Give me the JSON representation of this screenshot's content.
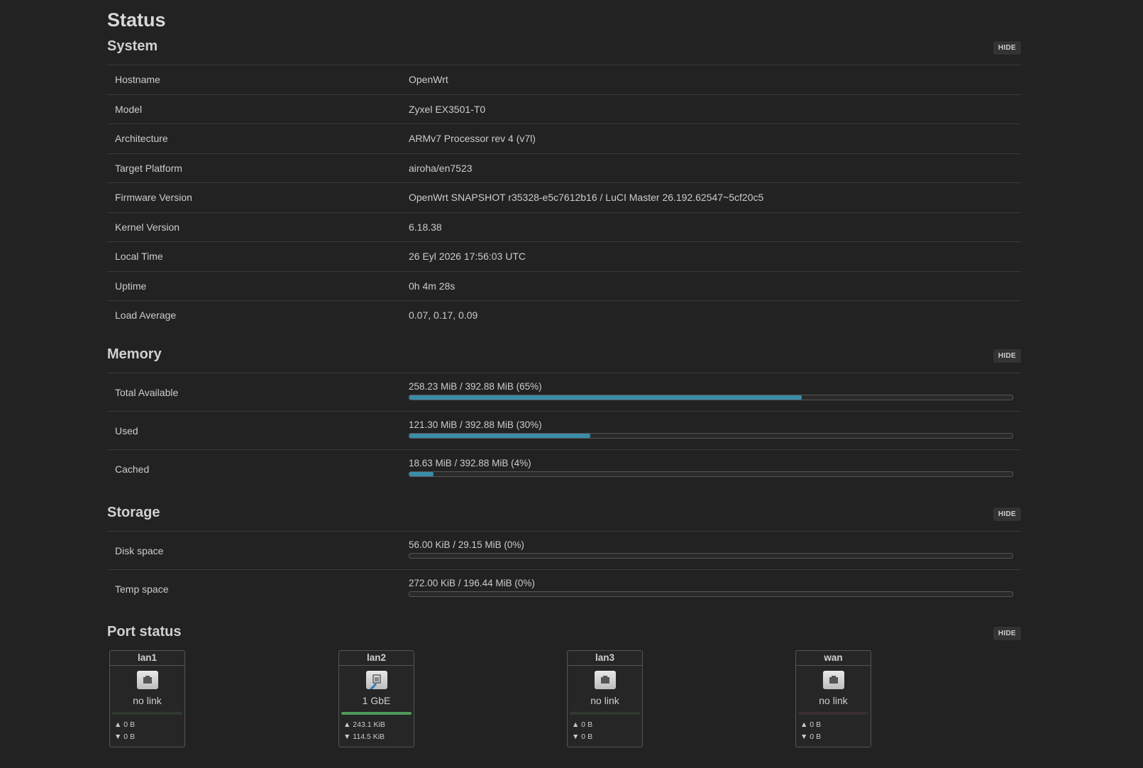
{
  "page_title": "Status",
  "hide_label": "HIDE",
  "system": {
    "title": "System",
    "rows": [
      {
        "key": "Hostname",
        "value": "OpenWrt"
      },
      {
        "key": "Model",
        "value": "Zyxel EX3501-T0"
      },
      {
        "key": "Architecture",
        "value": "ARMv7 Processor rev 4 (v7l)"
      },
      {
        "key": "Target Platform",
        "value": "airoha/en7523"
      },
      {
        "key": "Firmware Version",
        "value": "OpenWrt SNAPSHOT r35328-e5c7612b16 / LuCI Master 26.192.62547~5cf20c5"
      },
      {
        "key": "Kernel Version",
        "value": "6.18.38"
      },
      {
        "key": "Local Time",
        "value": "26 Eyl 2026 17:56:03 UTC"
      },
      {
        "key": "Uptime",
        "value": "0h 4m 28s"
      },
      {
        "key": "Load Average",
        "value": "0.07, 0.17, 0.09"
      }
    ]
  },
  "memory": {
    "title": "Memory",
    "rows": [
      {
        "key": "Total Available",
        "label": "258.23 MiB / 392.88 MiB (65%)",
        "fraction": 0.65
      },
      {
        "key": "Used",
        "label": "121.30 MiB / 392.88 MiB (30%)",
        "fraction": 0.3
      },
      {
        "key": "Cached",
        "label": "18.63 MiB / 392.88 MiB (4%)",
        "fraction": 0.04
      }
    ]
  },
  "storage": {
    "title": "Storage",
    "rows": [
      {
        "key": "Disk space",
        "label": "56.00 KiB / 29.15 MiB (0%)",
        "fraction": 0.0
      },
      {
        "key": "Temp space",
        "label": "272.00 KiB / 196.44 MiB (0%)",
        "fraction": 0.0
      }
    ]
  },
  "ports": {
    "title": "Port status",
    "items": [
      {
        "name": "lan1",
        "speed": "no link",
        "tx": "▲ 0 B",
        "rx": "▼ 0 B",
        "connected": false
      },
      {
        "name": "lan2",
        "speed": "1 GbE",
        "tx": "▲ 243.1 KiB",
        "rx": "▼ 114.5 KiB",
        "connected": true
      },
      {
        "name": "lan3",
        "speed": "no link",
        "tx": "▲ 0 B",
        "rx": "▼ 0 B",
        "connected": false
      },
      {
        "name": "wan",
        "speed": "no link",
        "tx": "▲ 0 B",
        "rx": "▼ 0 B",
        "connected": false
      }
    ]
  },
  "colors": {
    "background": "#222222",
    "bar_fill": "#3a8ca8",
    "port_led_active": "#4f9a5a"
  }
}
